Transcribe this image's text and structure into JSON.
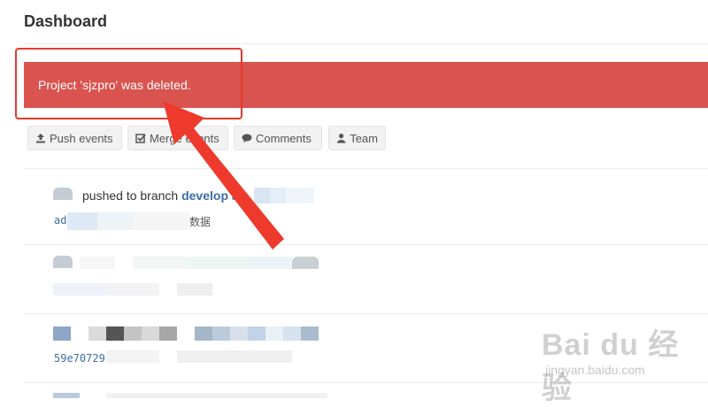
{
  "header": {
    "title": "Dashboard"
  },
  "alert": {
    "message": "Project 'sjzpro' was deleted.",
    "color": "#d9534f"
  },
  "filters": [
    {
      "label": "Push events",
      "icon": "upload-icon"
    },
    {
      "label": "Merge events",
      "icon": "checkbox-icon"
    },
    {
      "label": "Comments",
      "icon": "comments-icon"
    },
    {
      "label": "Team",
      "icon": "user-icon"
    }
  ],
  "feed": {
    "event1": {
      "action": "pushed to branch",
      "branch": "develop",
      "connector": "at",
      "commit_prefix": "ad",
      "commit_suffix": "数据"
    },
    "event3": {
      "commit_sha": "59e70729"
    }
  },
  "annotation": {
    "highlight_color": "#e8392e"
  },
  "watermark": {
    "logo": "Bai du 经验",
    "url": "jingyan.baidu.com"
  }
}
